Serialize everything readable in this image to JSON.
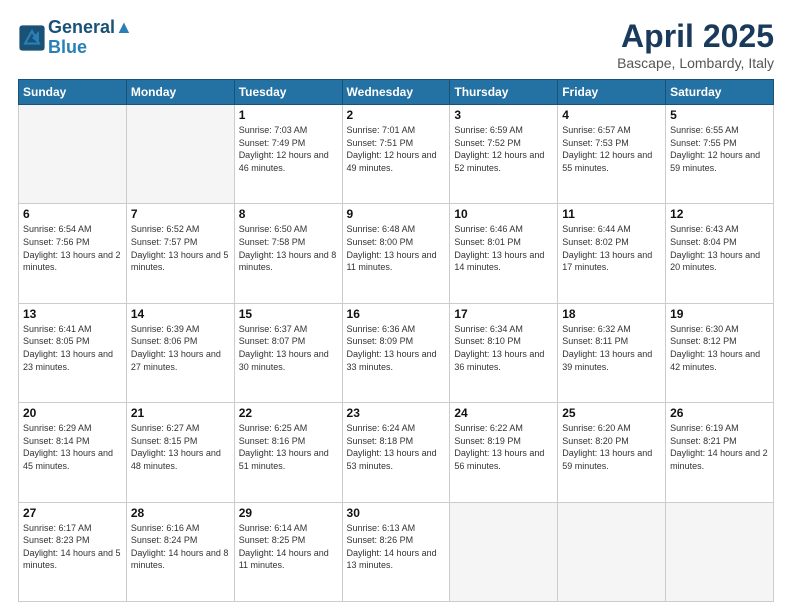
{
  "header": {
    "logo_line1": "General",
    "logo_line2": "Blue",
    "month": "April 2025",
    "location": "Bascape, Lombardy, Italy"
  },
  "weekdays": [
    "Sunday",
    "Monday",
    "Tuesday",
    "Wednesday",
    "Thursday",
    "Friday",
    "Saturday"
  ],
  "weeks": [
    [
      {
        "day": "",
        "info": ""
      },
      {
        "day": "",
        "info": ""
      },
      {
        "day": "1",
        "info": "Sunrise: 7:03 AM\nSunset: 7:49 PM\nDaylight: 12 hours and 46 minutes."
      },
      {
        "day": "2",
        "info": "Sunrise: 7:01 AM\nSunset: 7:51 PM\nDaylight: 12 hours and 49 minutes."
      },
      {
        "day": "3",
        "info": "Sunrise: 6:59 AM\nSunset: 7:52 PM\nDaylight: 12 hours and 52 minutes."
      },
      {
        "day": "4",
        "info": "Sunrise: 6:57 AM\nSunset: 7:53 PM\nDaylight: 12 hours and 55 minutes."
      },
      {
        "day": "5",
        "info": "Sunrise: 6:55 AM\nSunset: 7:55 PM\nDaylight: 12 hours and 59 minutes."
      }
    ],
    [
      {
        "day": "6",
        "info": "Sunrise: 6:54 AM\nSunset: 7:56 PM\nDaylight: 13 hours and 2 minutes."
      },
      {
        "day": "7",
        "info": "Sunrise: 6:52 AM\nSunset: 7:57 PM\nDaylight: 13 hours and 5 minutes."
      },
      {
        "day": "8",
        "info": "Sunrise: 6:50 AM\nSunset: 7:58 PM\nDaylight: 13 hours and 8 minutes."
      },
      {
        "day": "9",
        "info": "Sunrise: 6:48 AM\nSunset: 8:00 PM\nDaylight: 13 hours and 11 minutes."
      },
      {
        "day": "10",
        "info": "Sunrise: 6:46 AM\nSunset: 8:01 PM\nDaylight: 13 hours and 14 minutes."
      },
      {
        "day": "11",
        "info": "Sunrise: 6:44 AM\nSunset: 8:02 PM\nDaylight: 13 hours and 17 minutes."
      },
      {
        "day": "12",
        "info": "Sunrise: 6:43 AM\nSunset: 8:04 PM\nDaylight: 13 hours and 20 minutes."
      }
    ],
    [
      {
        "day": "13",
        "info": "Sunrise: 6:41 AM\nSunset: 8:05 PM\nDaylight: 13 hours and 23 minutes."
      },
      {
        "day": "14",
        "info": "Sunrise: 6:39 AM\nSunset: 8:06 PM\nDaylight: 13 hours and 27 minutes."
      },
      {
        "day": "15",
        "info": "Sunrise: 6:37 AM\nSunset: 8:07 PM\nDaylight: 13 hours and 30 minutes."
      },
      {
        "day": "16",
        "info": "Sunrise: 6:36 AM\nSunset: 8:09 PM\nDaylight: 13 hours and 33 minutes."
      },
      {
        "day": "17",
        "info": "Sunrise: 6:34 AM\nSunset: 8:10 PM\nDaylight: 13 hours and 36 minutes."
      },
      {
        "day": "18",
        "info": "Sunrise: 6:32 AM\nSunset: 8:11 PM\nDaylight: 13 hours and 39 minutes."
      },
      {
        "day": "19",
        "info": "Sunrise: 6:30 AM\nSunset: 8:12 PM\nDaylight: 13 hours and 42 minutes."
      }
    ],
    [
      {
        "day": "20",
        "info": "Sunrise: 6:29 AM\nSunset: 8:14 PM\nDaylight: 13 hours and 45 minutes."
      },
      {
        "day": "21",
        "info": "Sunrise: 6:27 AM\nSunset: 8:15 PM\nDaylight: 13 hours and 48 minutes."
      },
      {
        "day": "22",
        "info": "Sunrise: 6:25 AM\nSunset: 8:16 PM\nDaylight: 13 hours and 51 minutes."
      },
      {
        "day": "23",
        "info": "Sunrise: 6:24 AM\nSunset: 8:18 PM\nDaylight: 13 hours and 53 minutes."
      },
      {
        "day": "24",
        "info": "Sunrise: 6:22 AM\nSunset: 8:19 PM\nDaylight: 13 hours and 56 minutes."
      },
      {
        "day": "25",
        "info": "Sunrise: 6:20 AM\nSunset: 8:20 PM\nDaylight: 13 hours and 59 minutes."
      },
      {
        "day": "26",
        "info": "Sunrise: 6:19 AM\nSunset: 8:21 PM\nDaylight: 14 hours and 2 minutes."
      }
    ],
    [
      {
        "day": "27",
        "info": "Sunrise: 6:17 AM\nSunset: 8:23 PM\nDaylight: 14 hours and 5 minutes."
      },
      {
        "day": "28",
        "info": "Sunrise: 6:16 AM\nSunset: 8:24 PM\nDaylight: 14 hours and 8 minutes."
      },
      {
        "day": "29",
        "info": "Sunrise: 6:14 AM\nSunset: 8:25 PM\nDaylight: 14 hours and 11 minutes."
      },
      {
        "day": "30",
        "info": "Sunrise: 6:13 AM\nSunset: 8:26 PM\nDaylight: 14 hours and 13 minutes."
      },
      {
        "day": "",
        "info": ""
      },
      {
        "day": "",
        "info": ""
      },
      {
        "day": "",
        "info": ""
      }
    ]
  ]
}
